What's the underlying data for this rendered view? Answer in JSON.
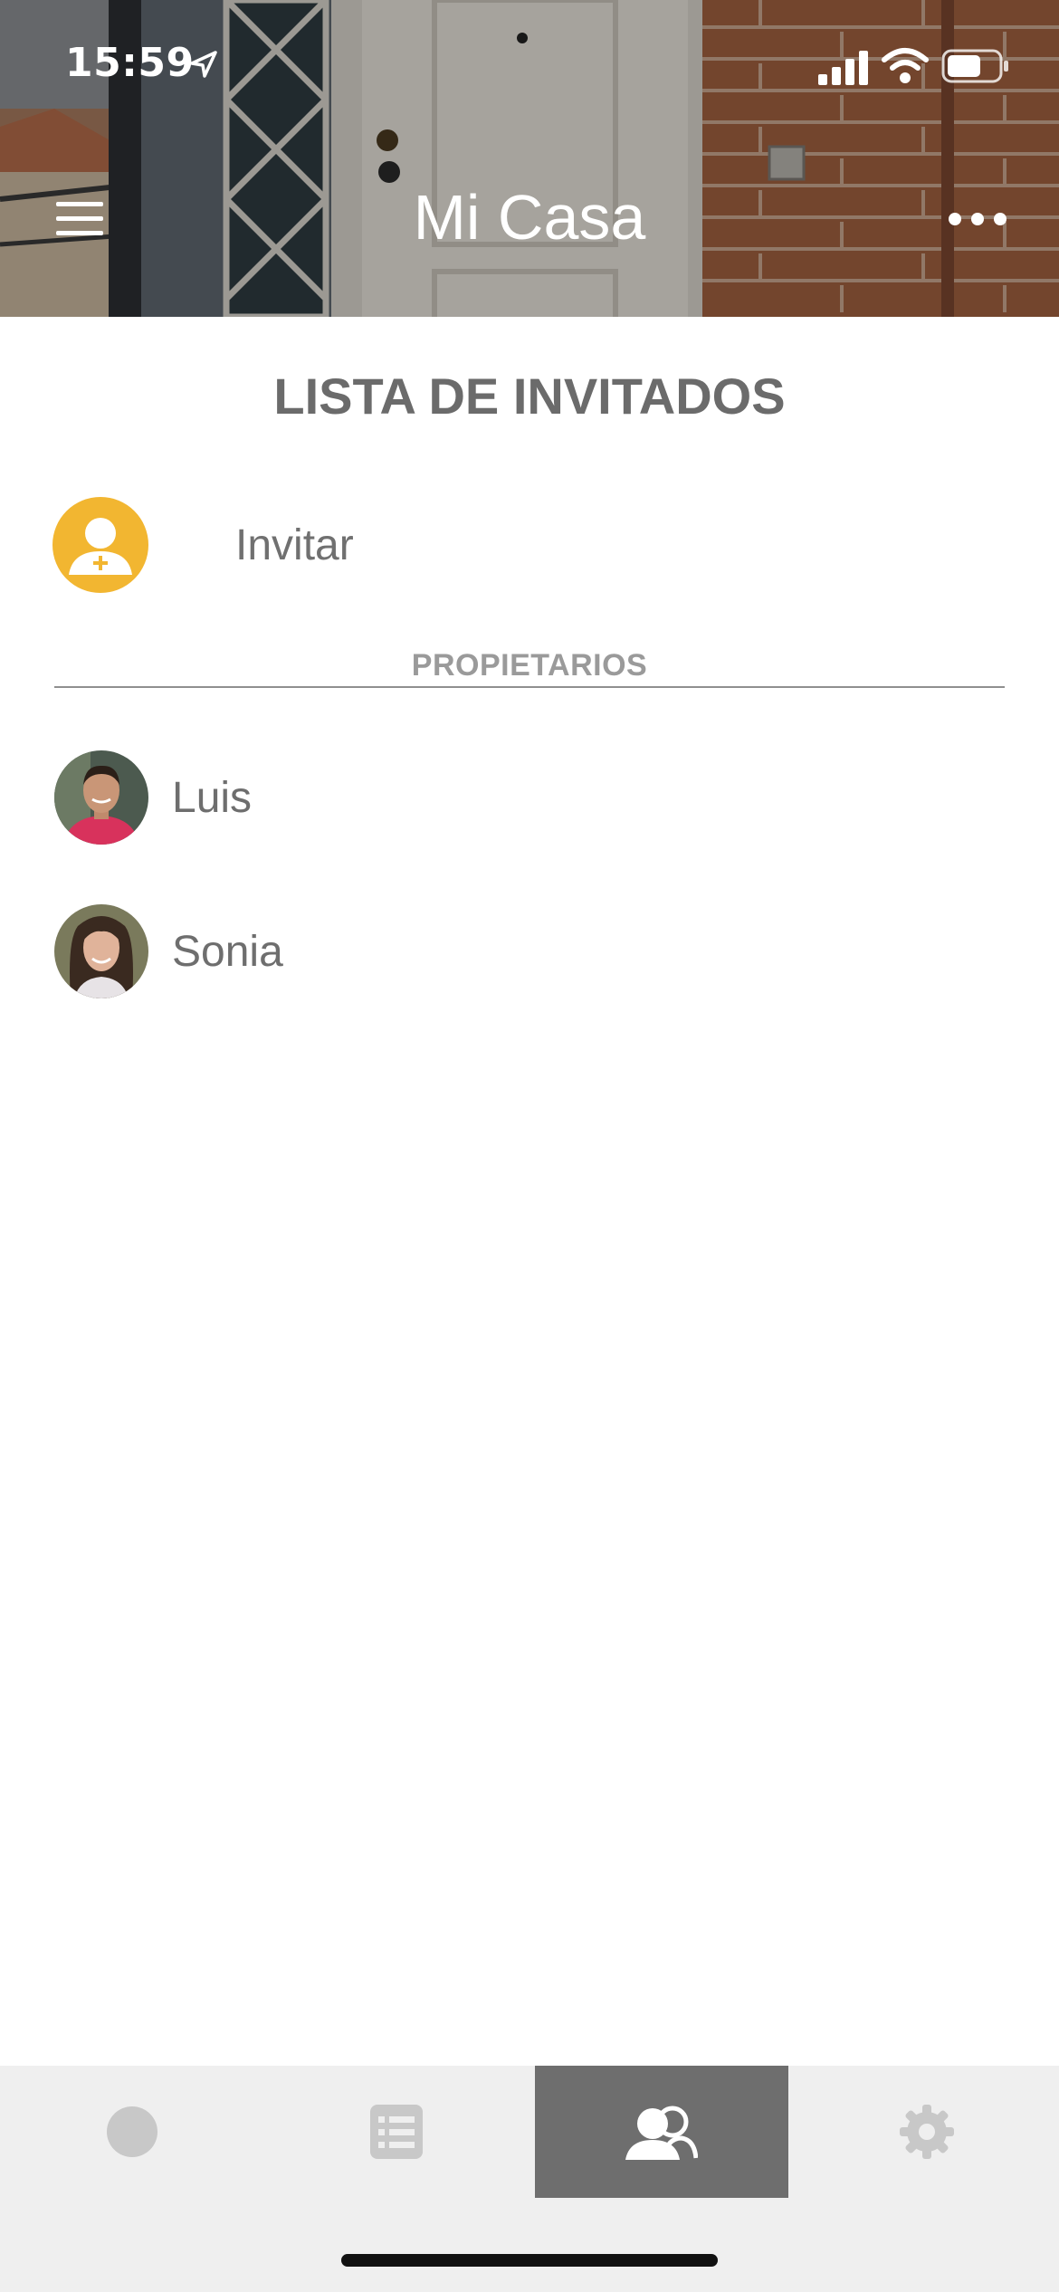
{
  "status_bar": {
    "time": "15:59"
  },
  "header": {
    "title": "Mi Casa",
    "menu_icon": "hamburger-menu-icon",
    "more_icon": "more-horizontal-icon"
  },
  "guest_list": {
    "title": "LISTA DE INVITADOS",
    "invite": {
      "label": "Invitar",
      "icon": "add-user-icon",
      "color": "#f2b631"
    },
    "owners_header": "PROPIETARIOS",
    "owners": [
      {
        "name": "Luis"
      },
      {
        "name": "Sonia"
      }
    ]
  },
  "tab_bar": {
    "tabs": [
      {
        "icon": "circle-icon",
        "active": false
      },
      {
        "icon": "list-icon",
        "active": false
      },
      {
        "icon": "users-icon",
        "active": true
      },
      {
        "icon": "gear-icon",
        "active": false
      }
    ],
    "active_color": "#6e6e6e",
    "background": "#efefef"
  }
}
